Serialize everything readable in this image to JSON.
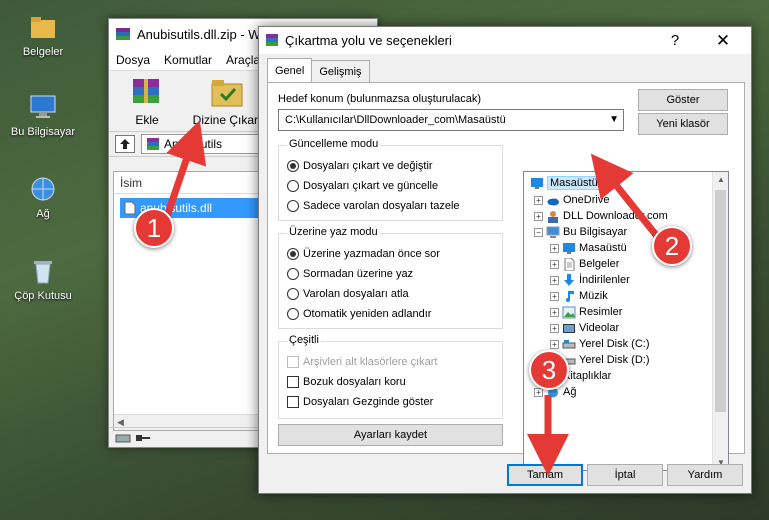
{
  "desktop": {
    "icons": [
      {
        "label": "Belgeler",
        "icon": "folder-icon"
      },
      {
        "label": "Bu Bilgisayar",
        "icon": "computer-icon"
      },
      {
        "label": "Ağ",
        "icon": "network-icon"
      },
      {
        "label": "Çöp Kutusu",
        "icon": "recycle-bin-icon"
      }
    ]
  },
  "winrar": {
    "title": "Anubisutils.dll.zip - W",
    "menu": [
      "Dosya",
      "Komutlar",
      "Araçlar"
    ],
    "toolbar": {
      "add": "Ekle",
      "extract_to": "Dizine Çıkart"
    },
    "path": "Anubisutils",
    "list_header": "İsim",
    "file": "anubisutils.dll"
  },
  "dialog": {
    "title": "Çıkartma yolu ve seçenekleri",
    "help_glyph": "?",
    "close_glyph": "✕",
    "tabs": [
      "Genel",
      "Gelişmiş"
    ],
    "dest_label": "Hedef konum (bulunmazsa oluşturulacak)",
    "dest_value": "C:\\Kullanıcılar\\DllDownloader_com\\Masaüstü",
    "show_button": "Göster",
    "new_folder_button": "Yeni klasör",
    "update_mode": {
      "title": "Güncelleme modu",
      "options": [
        "Dosyaları çıkart ve değiştir",
        "Dosyaları çıkart ve güncelle",
        "Sadece varolan dosyaları tazele"
      ],
      "selected": 0
    },
    "overwrite_mode": {
      "title": "Üzerine yaz modu",
      "options": [
        "Üzerine yazmadan önce sor",
        "Sormadan üzerine yaz",
        "Varolan dosyaları atla",
        "Otomatik yeniden adlandır"
      ],
      "selected": 0
    },
    "misc": {
      "title": "Çeşitli",
      "options": [
        {
          "label": "Arşivleri alt klasörlere çıkart",
          "checked": false,
          "disabled": true
        },
        {
          "label": "Bozuk dosyaları koru",
          "checked": false,
          "disabled": false
        },
        {
          "label": "Dosyaları Gezginde göster",
          "checked": false,
          "disabled": false
        }
      ]
    },
    "save_settings": "Ayarları kaydet",
    "tree": [
      {
        "label": "Masaüstü",
        "icon": "desktop-icon",
        "selected": true
      },
      {
        "label": "OneDrive",
        "icon": "cloud-icon"
      },
      {
        "label": "DLL Downloader.com",
        "icon": "user-icon"
      },
      {
        "label": "Bu Bilgisayar",
        "icon": "computer-icon"
      },
      {
        "label": "Masaüstü",
        "icon": "desktop-icon"
      },
      {
        "label": "Belgeler",
        "icon": "document-icon"
      },
      {
        "label": "İndirilenler",
        "icon": "download-icon"
      },
      {
        "label": "Müzik",
        "icon": "music-icon"
      },
      {
        "label": "Resimler",
        "icon": "pictures-icon"
      },
      {
        "label": "Videolar",
        "icon": "video-icon"
      },
      {
        "label": "Yerel Disk (C:)",
        "icon": "drive-icon"
      },
      {
        "label": "Yerel Disk (D:)",
        "icon": "drive-icon"
      },
      {
        "label": "Kitaplıklar",
        "icon": "library-icon"
      },
      {
        "label": "Ağ",
        "icon": "network-icon"
      }
    ],
    "buttons": {
      "ok": "Tamam",
      "cancel": "İptal",
      "help": "Yardım"
    }
  },
  "callouts": [
    "1",
    "2",
    "3"
  ],
  "colors": {
    "callout": "#e53935",
    "selection": "#cce8ff",
    "accent": "#0078d7"
  }
}
